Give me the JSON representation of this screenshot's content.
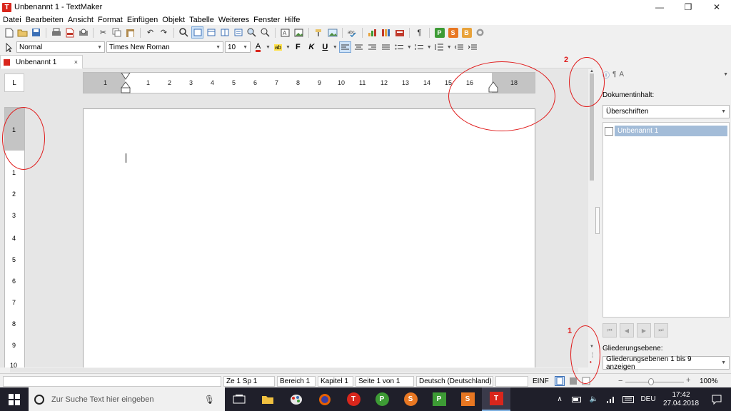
{
  "window": {
    "title": "Unbenannt 1 - TextMaker",
    "app_icon_letter": "T",
    "controls": {
      "minimize": "—",
      "maximize": "❐",
      "close": "✕"
    }
  },
  "menu": [
    "Datei",
    "Bearbeiten",
    "Ansicht",
    "Format",
    "Einfügen",
    "Objekt",
    "Tabelle",
    "Weiteres",
    "Fenster",
    "Hilfe"
  ],
  "toolbar": {
    "paragraph_style": "Normal",
    "font_name": "Times New Roman",
    "font_size": "10",
    "color_letter": "A",
    "highlight_label": "ab",
    "bold": "F",
    "italic": "K",
    "underline": "U",
    "extra_p": "P",
    "extra_s": "S",
    "extra_b": "B",
    "pilcrow": "¶"
  },
  "tab": {
    "label": "Unbenannt 1",
    "close": "×"
  },
  "ruler": {
    "corner": "L",
    "h_labels": [
      "1",
      "1",
      "2",
      "3",
      "4",
      "5",
      "6",
      "7",
      "8",
      "9",
      "10",
      "11",
      "12",
      "13",
      "14",
      "15",
      "16",
      "18"
    ],
    "v_labels": [
      "1",
      "1",
      "2",
      "3",
      "4",
      "5",
      "6",
      "7",
      "8",
      "9",
      "10"
    ]
  },
  "sidebar": {
    "content_label": "Dokumentinhalt:",
    "content_select": "Überschriften",
    "list_items": [
      "Unbenannt 1"
    ],
    "outline_label": "Gliederungsebene:",
    "outline_select": "Gliederungsebenen 1 bis 9 anzeigen"
  },
  "status": {
    "position": "Ze 1 Sp 1",
    "area": "Bereich 1",
    "chapter": "Kapitel 1",
    "page": "Seite 1 von 1",
    "language": "Deutsch (Deutschland)",
    "mode": "EINF",
    "zoom": "100%"
  },
  "taskbar": {
    "search_placeholder": "Zur Suche Text hier eingeben",
    "apps": [
      "T",
      "P",
      "S",
      "P",
      "S",
      "T"
    ],
    "language": "DEU",
    "time": "17:42",
    "date": "27.04.2018"
  },
  "annotations": [
    "1",
    "2"
  ],
  "colors": {
    "textmaker": "#d9261c",
    "planmaker": "#3d9b35",
    "presentations": "#e87722",
    "annotation": "#e01b1b"
  }
}
